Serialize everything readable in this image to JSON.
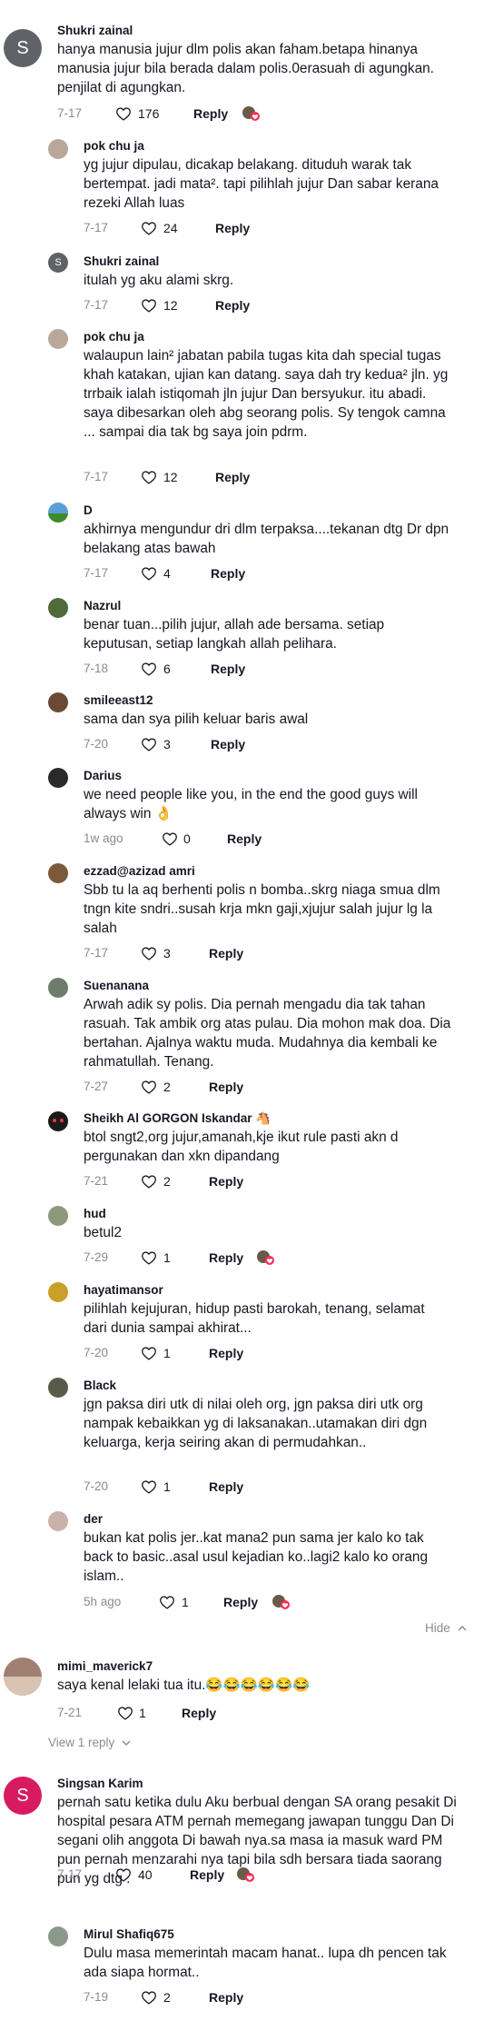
{
  "comments": [
    {
      "user": "Shukri zainal",
      "text": "hanya manusia jujur dlm polis akan faham.betapa hinanya manusia jujur bila berada dalam polis.0erasuah di agungkan. penjilat di agungkan.",
      "date": "7-17",
      "likes": "176",
      "reply": "Reply",
      "avatar_letter": "S",
      "avatar_color": "#5f6368",
      "creator_liked": true
    },
    {
      "user": "pok chu ja",
      "text": "yg jujur dipulau, dicakap belakang. dituduh warak tak bertempat. jadi mata². tapi pilihlah jujur Dan sabar kerana rezeki Allah luas",
      "date": "7-17",
      "likes": "24",
      "reply": "Reply",
      "avatar_color": "#b9a89a"
    },
    {
      "user": "Shukri zainal",
      "text": "itulah yg aku alami skrg.",
      "date": "7-17",
      "likes": "12",
      "reply": "Reply",
      "avatar_letter": "S",
      "avatar_color": "#5f6368"
    },
    {
      "user": "pok chu ja",
      "text": "walaupun lain² jabatan pabila tugas kita dah special tugas khah katakan, ujian kan datang. saya dah try kedua² jln. yg trrbaik ialah istiqomah jln jujur Dan bersyukur. itu abadi. saya dibesarkan oleh abg seorang polis. Sy tengok camna ... sampai dia tak bg saya join pdrm.",
      "date": "7-17",
      "likes": "12",
      "reply": "Reply",
      "avatar_color": "#b9a89a"
    },
    {
      "user": "D",
      "text": "akhirnya mengundur dri dlm terpaksa....tekanan dtg Dr dpn belakang atas bawah",
      "date": "7-17",
      "likes": "4",
      "reply": "Reply",
      "avatar_color": "#5aa0d8"
    },
    {
      "user": "Nazrul",
      "text": "benar tuan...pilih jujur, allah ade bersama. setiap keputusan, setiap langkah allah pelihara.",
      "date": "7-18",
      "likes": "6",
      "reply": "Reply",
      "avatar_color": "#4f6b3a"
    },
    {
      "user": "smileeast12",
      "text": "sama dan sya pilih keluar baris awal",
      "date": "7-20",
      "likes": "3",
      "reply": "Reply",
      "avatar_color": "#6b4a35"
    },
    {
      "user": "Darius",
      "text": "we need people like you, in the end the good guys will always win 👌",
      "date": "1w ago",
      "likes": "0",
      "reply": "Reply",
      "avatar_color": "#2a2a2a"
    },
    {
      "user": "ezzad@azizad amri",
      "text": "Sbb tu la aq berhenti polis n bomba..skrg niaga smua dlm tngn kite sndri..susah krja mkn gaji,xjujur salah jujur lg la salah",
      "date": "7-17",
      "likes": "3",
      "reply": "Reply",
      "avatar_color": "#7a5a3a"
    },
    {
      "user": "Suenanana",
      "text": "Arwah adik sy polis. Dia pernah mengadu dia tak tahan rasuah. Tak ambik org atas pulau. Dia mohon mak doa. Dia bertahan. Ajalnya waktu muda. Mudahnya dia kembali ke rahmatullah. Tenang.",
      "date": "7-27",
      "likes": "2",
      "reply": "Reply",
      "avatar_color": "#6e7d6a"
    },
    {
      "user": "Sheikh Al GORGON Iskandar 🐴",
      "text": "btol sngt2,org jujur,amanah,kje ikut rule pasti akn d pergunakan dan xkn dipandang",
      "date": "7-21",
      "likes": "2",
      "reply": "Reply",
      "avatar_color": "#1a1a1a"
    },
    {
      "user": "hud",
      "text": "betul2",
      "date": "7-29",
      "likes": "1",
      "reply": "Reply",
      "avatar_color": "#8b9a7a",
      "creator_liked": true
    },
    {
      "user": "hayatimansor",
      "text": "pilihlah kejujuran, hidup pasti barokah, tenang, selamat dari dunia sampai akhirat...",
      "date": "7-20",
      "likes": "1",
      "reply": "Reply",
      "avatar_color": "#c8a02a"
    },
    {
      "user": "Black",
      "text": "jgn paksa diri utk di nilai oleh org, jgn paksa diri utk org nampak kebaikkan yg di laksanakan..utamakan diri dgn keluarga, kerja seiring akan di permudahkan..",
      "date": "7-20",
      "likes": "1",
      "reply": "Reply",
      "avatar_color": "#5a5a4a"
    },
    {
      "user": "der",
      "text": "bukan kat polis jer..kat mana2 pun sama jer kalo ko tak back to basic..asal usul kejadian ko..lagi2 kalo ko orang islam..",
      "date": "5h ago",
      "likes": "1",
      "reply": "Reply",
      "avatar_color": "#c9b3a8",
      "creator_liked": true
    },
    {
      "user": "mimi_maverick7",
      "text": "saya kenal lelaki tua itu.😂😂😂😂😂😂",
      "date": "7-21",
      "likes": "1",
      "reply": "Reply",
      "avatar_color": "#a08070"
    },
    {
      "user": "Singsan Karim",
      "text": "pernah satu ketika dulu Aku berbual dengan SA orang pesakit Di hospital pesara ATM pernah memegang jawapan tunggu Dan Di segani olih anggota Di bawah nya.sa masa ia masuk ward PM pun pernah menzarahi nya tapi bila sdh bersara tiada saorang pun yg dtg .",
      "date": "7-17",
      "likes": "40",
      "reply": "Reply",
      "avatar_letter": "S",
      "avatar_color": "#d81b60",
      "creator_liked": true
    },
    {
      "user": "Mirul Shafiq675",
      "text": "Dulu masa memerintah macam hanat.. lupa dh pencen tak ada siapa hormat..",
      "date": "7-19",
      "likes": "2",
      "reply": "Reply",
      "avatar_color": "#8a9a8a"
    }
  ],
  "hide_label": "Hide",
  "view_replies_label": "View 1 reply",
  "colors": {
    "text": "#161823",
    "muted": "#8a8b91",
    "like_outline": "#161823"
  }
}
